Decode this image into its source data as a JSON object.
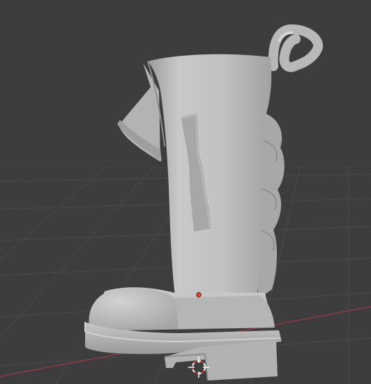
{
  "viewport": {
    "object": "boot",
    "colors": {
      "background": "#3d3d3d",
      "grid_line": "#4a4a4a",
      "x_axis": "#8a3a44",
      "mesh_light": "#c4c4c4",
      "mesh_mid": "#a9a9a9",
      "mesh_shadow": "#8d8d8d",
      "origin_dot": "#e0442e",
      "cursor": "#ffffff",
      "cursor_ring": "#d22a2a"
    },
    "icons": {
      "cursor": "3d-cursor-icon",
      "origin": "origin-dot-icon"
    }
  }
}
